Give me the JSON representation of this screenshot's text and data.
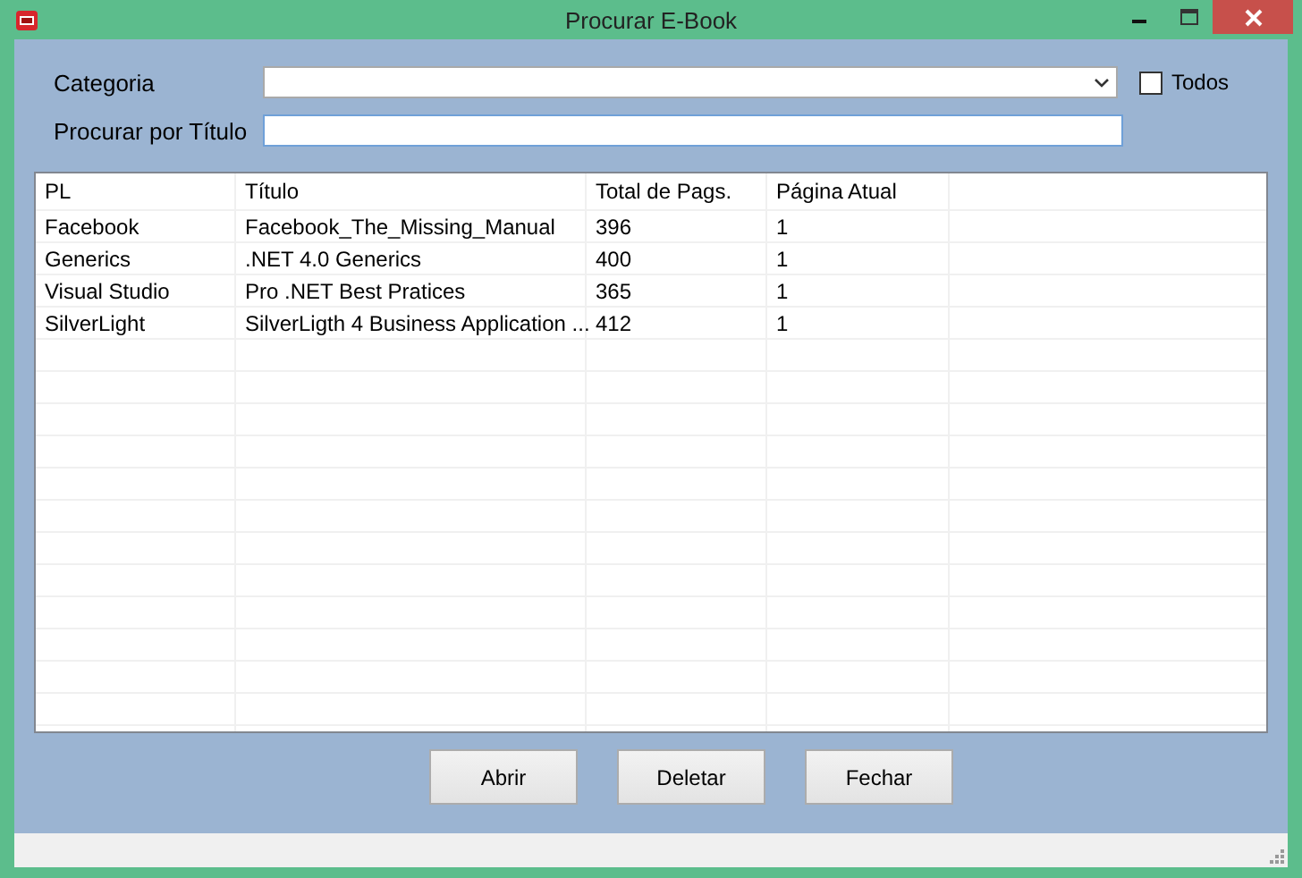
{
  "window": {
    "title": "Procurar E-Book"
  },
  "categoria": {
    "label": "Categoria",
    "todos": {
      "label": "Todos",
      "checked": false
    }
  },
  "titulo": {
    "label": "Procurar por Título"
  },
  "table": {
    "columns": [
      "PL",
      "Título",
      "Total de Pags.",
      "Página Atual"
    ],
    "rows": [
      [
        "Facebook",
        "Facebook_The_Missing_Manual",
        "396",
        "1"
      ],
      [
        "Generics",
        ".NET 4.0 Generics",
        "400",
        "1"
      ],
      [
        "Visual Studio",
        "Pro .NET Best Pratices",
        "365",
        "1"
      ],
      [
        "SilverLight",
        "SilverLigth 4 Business Application ...",
        "412",
        "1"
      ]
    ]
  },
  "buttons": [
    "Abrir",
    "Deletar",
    "Fechar"
  ]
}
